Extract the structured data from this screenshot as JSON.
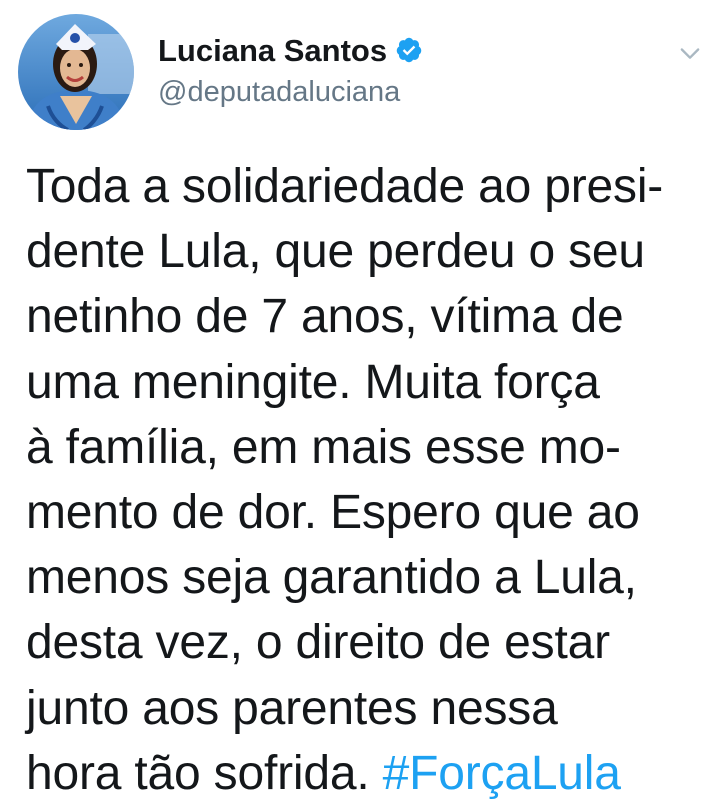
{
  "author": {
    "display_name": "Luciana Santos",
    "handle": "@deputadaluciana",
    "verified": true,
    "avatar_icon": "avatar-photo"
  },
  "tweet": {
    "text": "Toda a solidariedade ao presi-\ndente Lula, que perdeu o seu\nnetinho de 7 anos, vítima de\numa meningite. Muita força\nà família, em mais esse mo-\nmento de dor. Espero que ao\nmenos seja garantido a Lula,\ndesta vez, o direito de estar\njunto aos parentes nessa\nhora tão sofrida. ",
    "hashtag": "#ForçaLula"
  },
  "menu_icon": "chevron-down-icon",
  "colors": {
    "text": "#14171a",
    "secondary": "#657786",
    "link": "#1da1f2",
    "verified": "#1da1f2"
  }
}
